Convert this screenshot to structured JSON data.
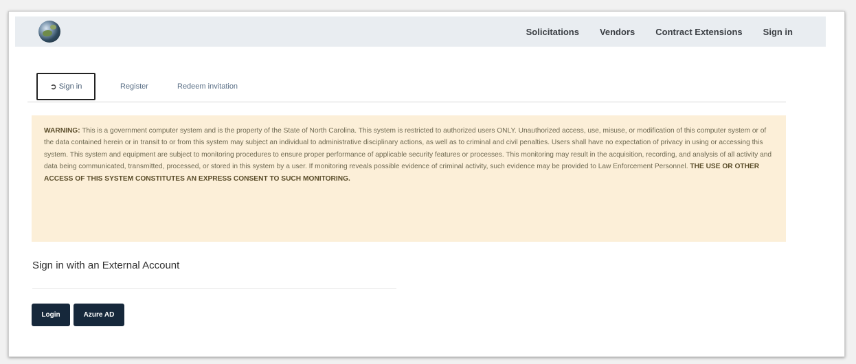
{
  "navbar": {
    "logo_icon": "globe-icon",
    "links": [
      "Solicitations",
      "Vendors",
      "Contract Extensions",
      "Sign in"
    ]
  },
  "tabs": {
    "sign_in": "Sign in",
    "sign_in_icon": "sign-in-icon",
    "register": "Register",
    "redeem": "Redeem invitation"
  },
  "warning": {
    "label": "WARNING:",
    "body": " This is a government computer system and is the property of the State of North Carolina. This system is restricted to authorized users ONLY. Unauthorized access, use, misuse, or modification of this computer system or of the data contained herein or in transit to or from this system may subject an individual to administrative disciplinary actions, as well as to criminal and civil penalties. Users shall have no expectation of privacy in using or accessing this system. This system and equipment are subject to monitoring procedures to ensure proper performance of applicable security features or processes. This monitoring may result in the acquisition, recording, and analysis of all activity and data being communicated, transmitted, processed, or stored in this system by a user. If monitoring reveals possible evidence of criminal activity, such evidence may be provided to Law Enforcement Personnel. ",
    "consent": "THE USE OR OTHER ACCESS OF THIS SYSTEM CONSTITUTES AN EXPRESS CONSENT TO SUCH MONITORING."
  },
  "external": {
    "title": "Sign in with an External Account",
    "buttons": {
      "login": "Login",
      "azure": "Azure AD"
    }
  },
  "colors": {
    "navbar_bg": "#e9edf1",
    "warning_bg": "#fcefd8",
    "button_bg": "#16283b"
  }
}
